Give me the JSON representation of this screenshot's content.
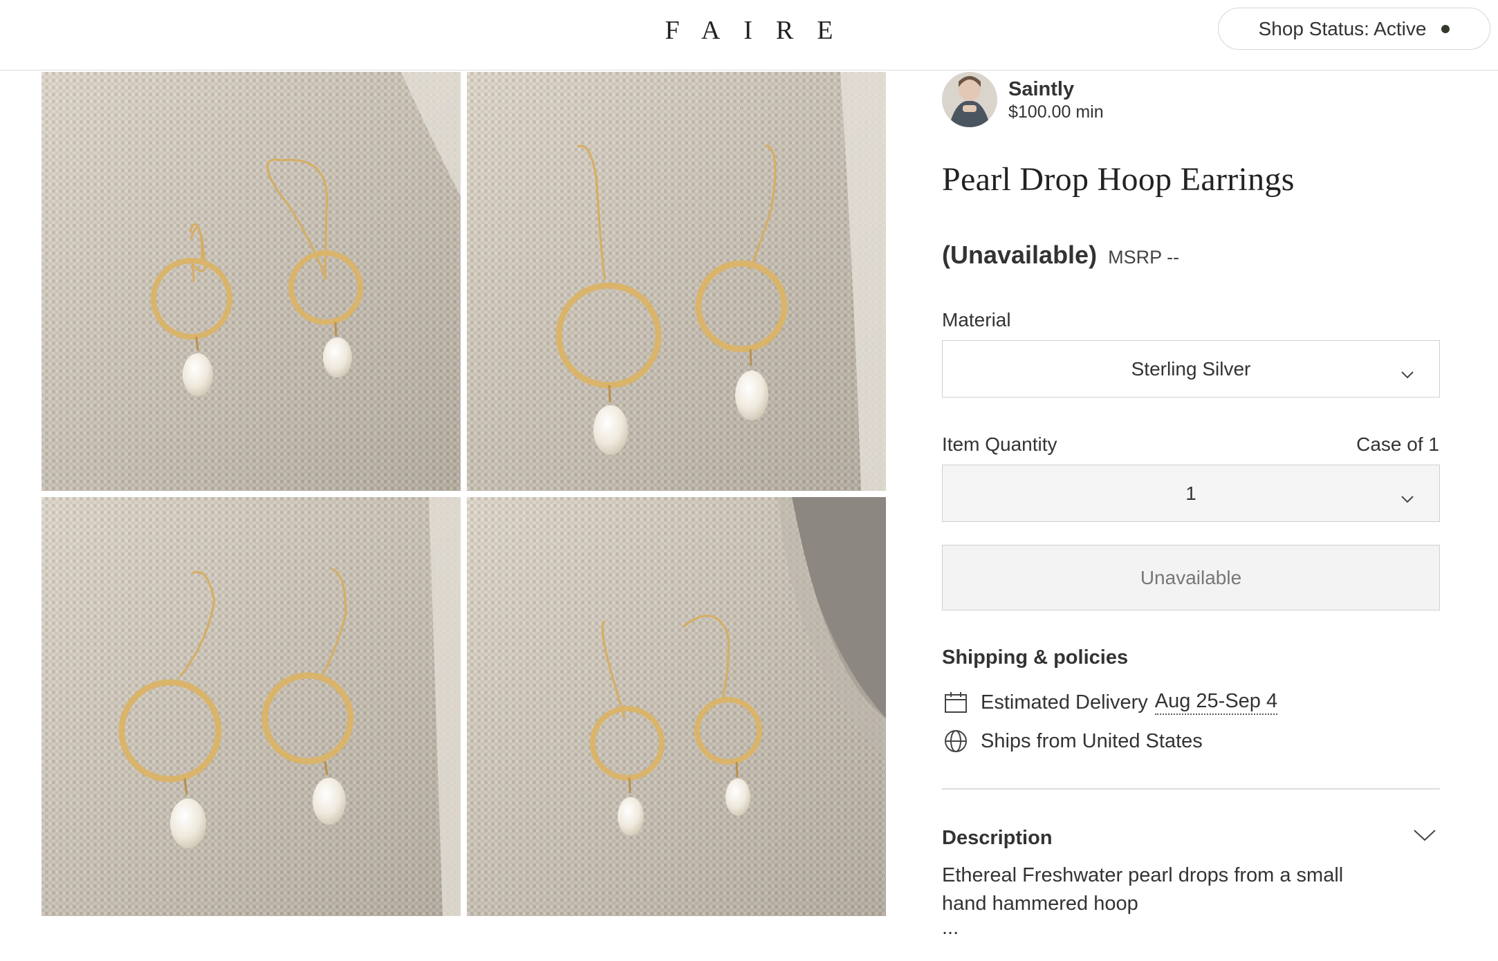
{
  "header": {
    "logo": "FAIRE",
    "shop_status_label": "Shop Status: Active"
  },
  "gallery": {
    "images": [
      "product-image-1",
      "product-image-2",
      "product-image-3",
      "product-image-4"
    ]
  },
  "seller": {
    "name": "Saintly",
    "minimum": "$100.00 min"
  },
  "product": {
    "title": "Pearl Drop Hoop Earrings",
    "price_status": "(Unavailable)",
    "msrp": "MSRP --"
  },
  "options": {
    "material_label": "Material",
    "material_value": "Sterling Silver",
    "quantity_label": "Item Quantity",
    "case_label": "Case of 1",
    "quantity_value": "1",
    "add_button_label": "Unavailable"
  },
  "shipping": {
    "heading": "Shipping & policies",
    "delivery_label": "Estimated Delivery",
    "delivery_date": "Aug 25-Sep 4",
    "ships_from": "Ships from United States",
    "icons": [
      "calendar-icon",
      "globe-icon"
    ]
  },
  "description": {
    "heading": "Description",
    "text": "Ethereal Freshwater pearl drops from a small hand hammered hoop",
    "more": "..."
  },
  "colors": {
    "status_dot": "#333a2c",
    "gold": "#d9b46a",
    "linen": "#cfc6b8"
  }
}
